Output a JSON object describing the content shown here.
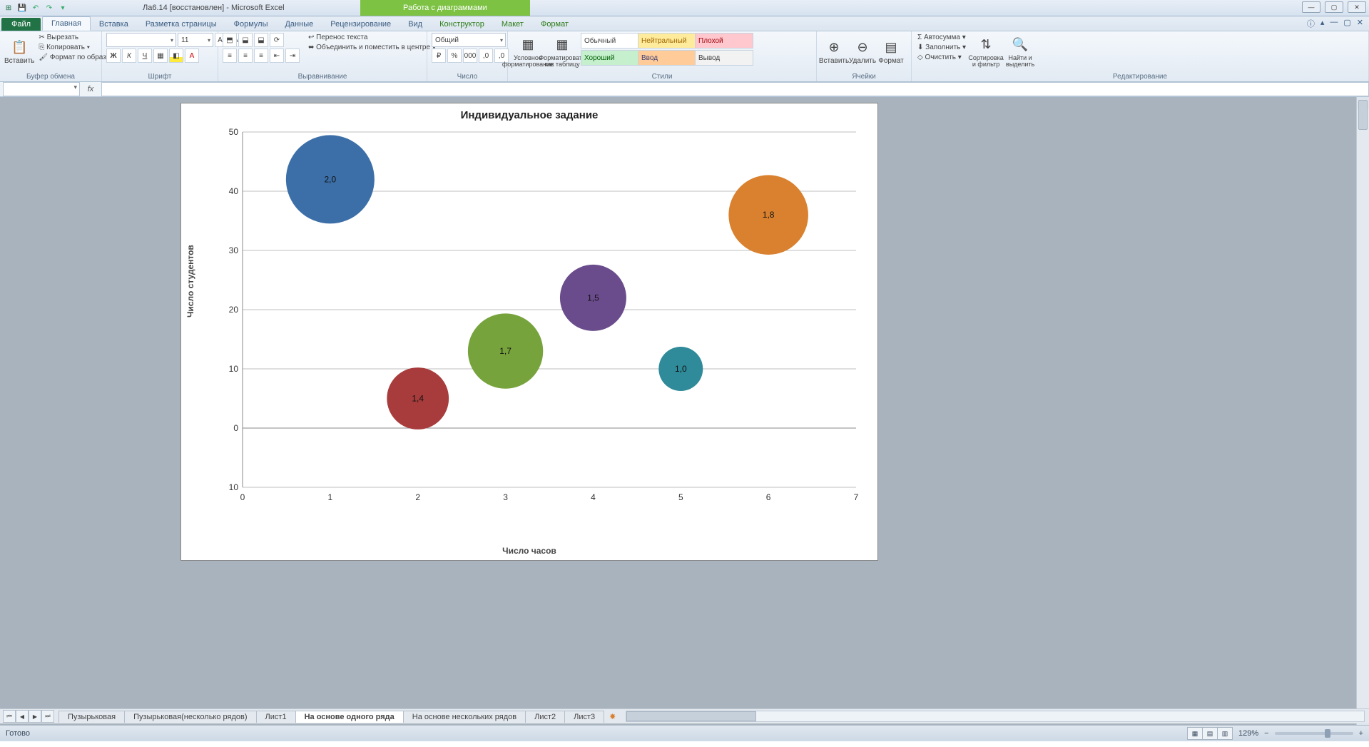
{
  "app": {
    "doc_title": "Ла6.14 [восстановлен] - Microsoft Excel",
    "context_tab": "Работа с диаграммами"
  },
  "tabs": {
    "file": "Файл",
    "items": [
      "Главная",
      "Вставка",
      "Разметка страницы",
      "Формулы",
      "Данные",
      "Рецензирование",
      "Вид",
      "Конструктор",
      "Макет",
      "Формат"
    ],
    "active": "Главная"
  },
  "ribbon": {
    "clipboard": {
      "label": "Буфер обмена",
      "paste": "Вставить",
      "cut": "Вырезать",
      "copy": "Копировать",
      "format_painter": "Формат по образцу"
    },
    "font": {
      "label": "Шрифт",
      "size": "11"
    },
    "alignment": {
      "label": "Выравнивание",
      "wrap": "Перенос текста",
      "merge": "Объединить и поместить в центре"
    },
    "number": {
      "label": "Число",
      "format": "Общий"
    },
    "styles": {
      "label": "Стили",
      "cond": "Условное форматирование",
      "table": "Форматировать как таблицу",
      "cells": [
        "Обычный",
        "Нейтральный",
        "Плохой",
        "Хороший",
        "Ввод",
        "Вывод"
      ]
    },
    "cells_grp": {
      "label": "Ячейки",
      "insert": "Вставить",
      "delete": "Удалить",
      "format": "Формат"
    },
    "editing": {
      "label": "Редактирование",
      "autosum": "Автосумма",
      "fill": "Заполнить",
      "clear": "Очистить",
      "sort": "Сортировка и фильтр",
      "find": "Найти и выделить"
    }
  },
  "chart_data": {
    "type": "bubble",
    "title": "Индивидуальное задание",
    "xlabel": "Число часов",
    "ylabel": "Число студентов",
    "xlim": [
      0,
      7
    ],
    "ylim": [
      -10,
      50
    ],
    "xticks": [
      0,
      1,
      2,
      3,
      4,
      5,
      6,
      7
    ],
    "yticks": [
      -10,
      0,
      10,
      20,
      30,
      40,
      50
    ],
    "points": [
      {
        "x": 1,
        "y": 42,
        "size": 2.0,
        "label": "2,0",
        "color": "#3c6fa8"
      },
      {
        "x": 2,
        "y": 5,
        "size": 1.4,
        "label": "1,4",
        "color": "#a83c3c"
      },
      {
        "x": 3,
        "y": 13,
        "size": 1.7,
        "label": "1,7",
        "color": "#77a33c"
      },
      {
        "x": 4,
        "y": 22,
        "size": 1.5,
        "label": "1,5",
        "color": "#6a4c8c"
      },
      {
        "x": 5,
        "y": 10,
        "size": 1.0,
        "label": "1,0",
        "color": "#2f8a99"
      },
      {
        "x": 6,
        "y": 36,
        "size": 1.8,
        "label": "1,8",
        "color": "#d9812e"
      }
    ]
  },
  "sheets": {
    "tabs": [
      "Пузырьковая",
      "Пузырьковая(несколько рядов)",
      "Лист1",
      "На основе одного ряда",
      "На основе нескольких рядов",
      "Лист2",
      "Лист3"
    ],
    "active": "На основе одного ряда"
  },
  "status": {
    "ready": "Готово",
    "zoom": "129%"
  }
}
